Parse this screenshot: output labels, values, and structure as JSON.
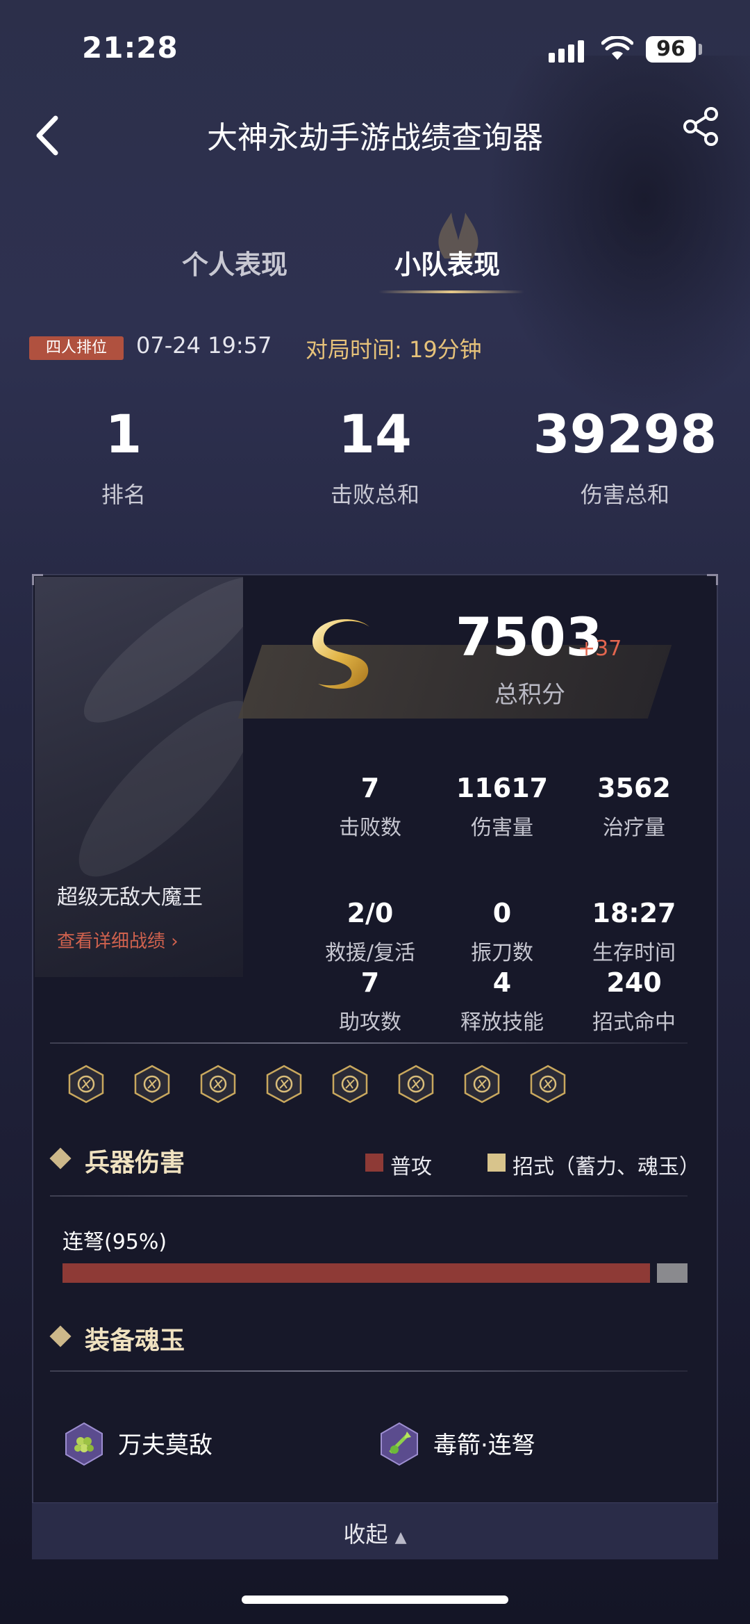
{
  "status_bar": {
    "time": "21:28",
    "battery": "96"
  },
  "nav": {
    "title": "大神永劫手游战绩查询器"
  },
  "tabs": [
    {
      "label": "个人表现",
      "active": false
    },
    {
      "label": "小队表现",
      "active": true
    }
  ],
  "match": {
    "mode": "四人排位",
    "datetime": "07-24 19:57",
    "duration": "对局时间: 19分钟"
  },
  "summary": [
    {
      "value": "1",
      "label": "排名"
    },
    {
      "value": "14",
      "label": "击败总和"
    },
    {
      "value": "39298",
      "label": "伤害总和"
    }
  ],
  "player": {
    "name": "超级无敌大魔王",
    "detail_link": "查看详细战绩"
  },
  "score": {
    "rank_letter": "S",
    "total": "7503",
    "delta": "+37",
    "label": "总积分"
  },
  "stats": [
    {
      "value": "7",
      "label": "击败数"
    },
    {
      "value": "11617",
      "label": "伤害量"
    },
    {
      "value": "3562",
      "label": "治疗量"
    },
    {
      "value": "2/0",
      "label": "救援/复活"
    },
    {
      "value": "0",
      "label": "振刀数"
    },
    {
      "value": "18:27",
      "label": "生存时间"
    },
    {
      "value": "7",
      "label": "助攻数"
    },
    {
      "value": "4",
      "label": "释放技能"
    },
    {
      "value": "240",
      "label": "招式命中"
    }
  ],
  "skill_icons": [
    "demon-mask-icon",
    "dragon-icon",
    "gate-icon",
    "crescent-blade-icon",
    "rune-icon",
    "bow-icon",
    "flower-icon",
    "boot-icon"
  ],
  "weapon_damage": {
    "title": "兵器伤害",
    "legend": [
      {
        "label": "普攻",
        "color": "#8e3a36"
      },
      {
        "label": "招式（蓄力、魂玉）",
        "color": "#d8c48c"
      }
    ],
    "weapons": [
      {
        "name": "连弩(95%)",
        "normal_fraction": 0.95
      }
    ]
  },
  "soul_jade": {
    "title": "装备魂玉",
    "items": [
      {
        "name": "万夫莫敌",
        "icon": "grape-cluster-icon"
      },
      {
        "name": "毒箭·连弩",
        "icon": "poison-arrow-icon"
      }
    ]
  },
  "collapse": {
    "label": "收起"
  },
  "colors": {
    "accent_gold": "#e6c27a",
    "badge_red": "#b0513f",
    "delta_red": "#e3664f"
  }
}
